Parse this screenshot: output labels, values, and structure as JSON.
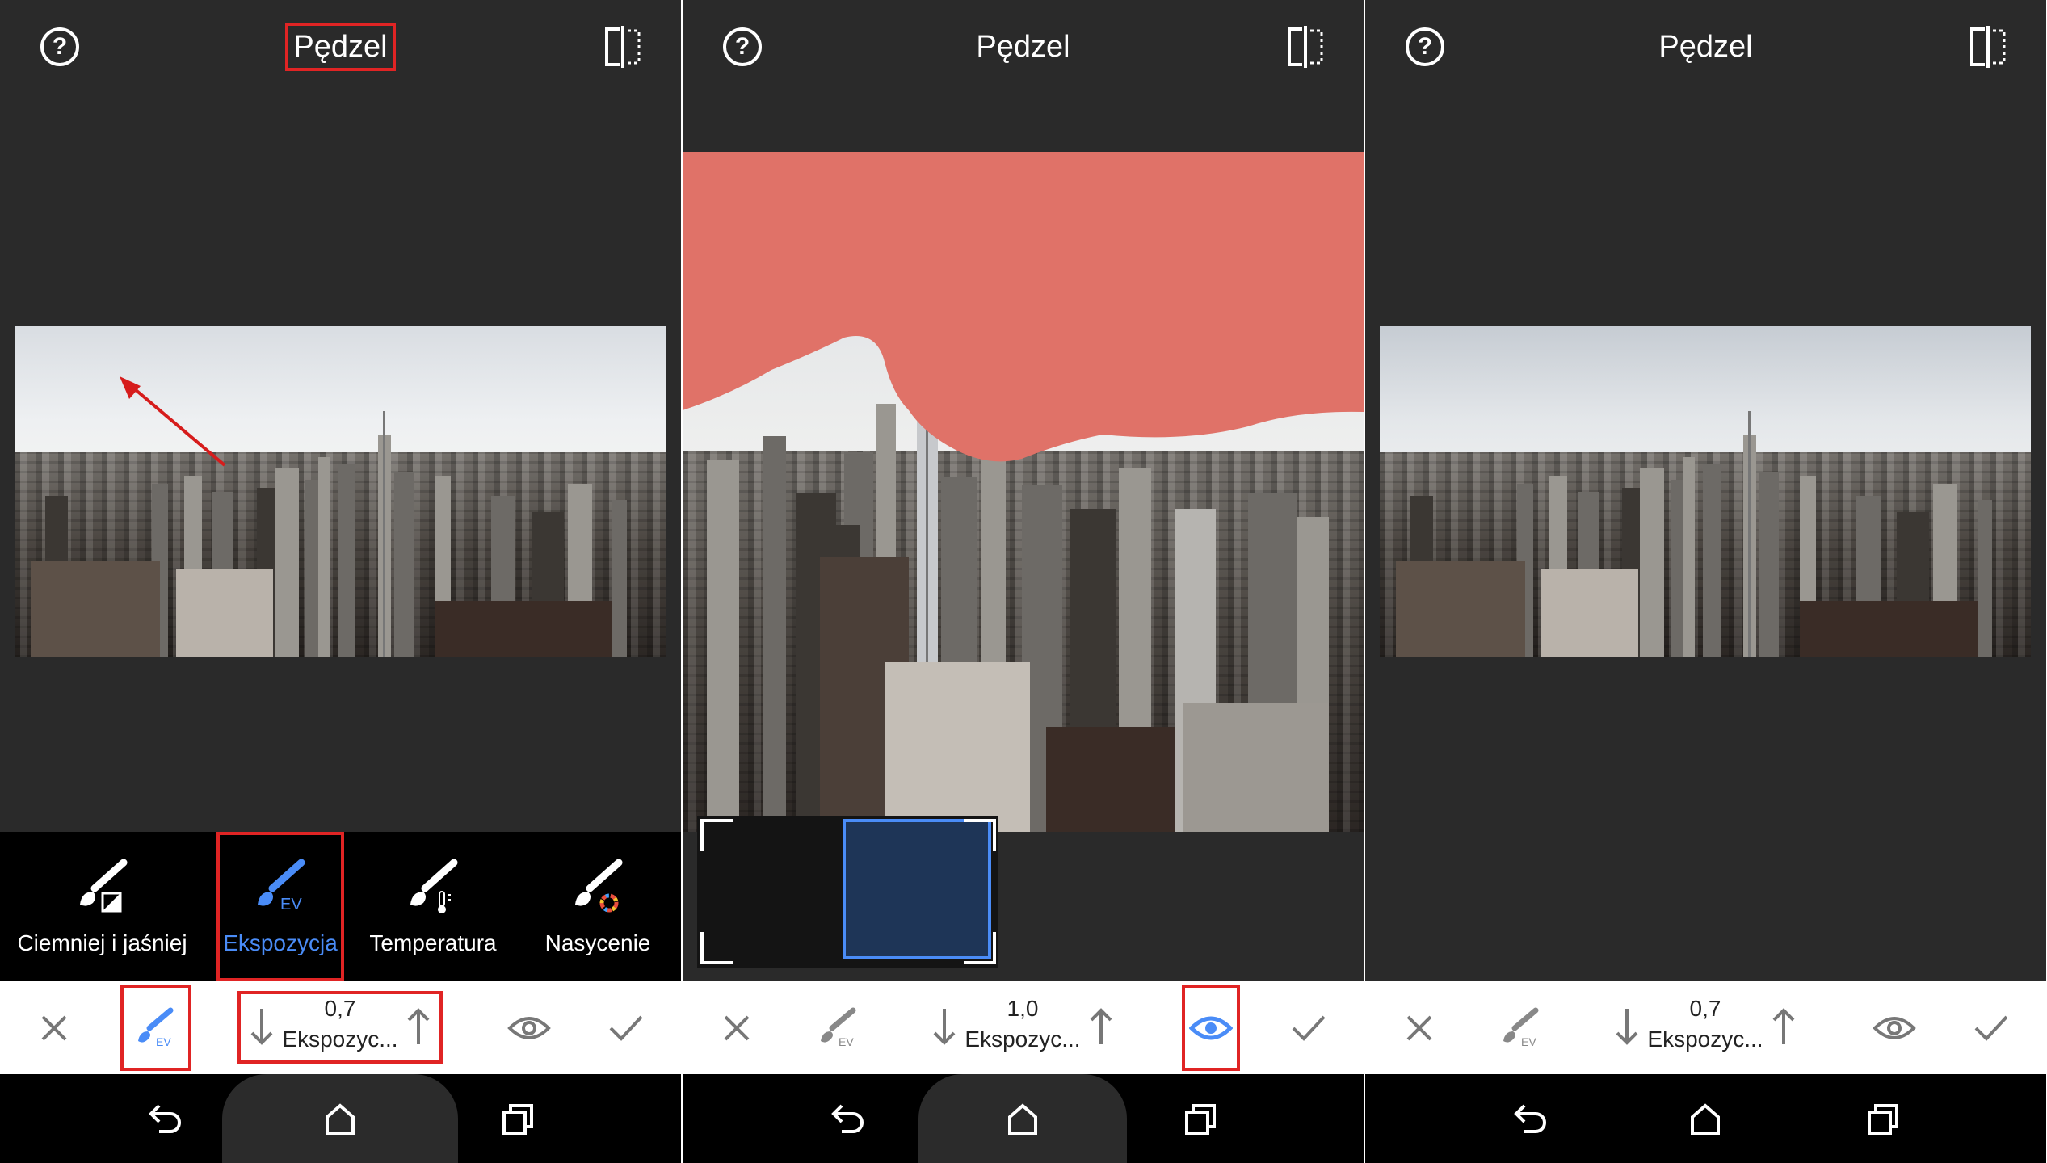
{
  "panels": [
    {
      "title": "Pędzel",
      "help_glyph": "?",
      "tools": [
        {
          "label": "Ciemniej i jaśniej",
          "icon": "brush-dodge-burn-icon"
        },
        {
          "label": "Ekspozycja",
          "icon": "brush-exposure-icon",
          "badge": "EV",
          "active": true
        },
        {
          "label": "Temperatura",
          "icon": "brush-temperature-icon"
        },
        {
          "label": "Nasycenie",
          "icon": "brush-saturation-icon"
        }
      ],
      "value": "0,7",
      "value_label": "Ekspozyc...",
      "brush_badge": "EV"
    },
    {
      "title": "Pędzel",
      "help_glyph": "?",
      "value": "1,0",
      "value_label": "Ekspozyc...",
      "brush_badge": "EV"
    },
    {
      "title": "Pędzel",
      "help_glyph": "?",
      "value": "0,7",
      "value_label": "Ekspozyc...",
      "brush_badge": "EV"
    }
  ],
  "colors": {
    "highlight_red": "#e02424",
    "accent_blue": "#4a8cf7",
    "mask_red": "#e07268",
    "background": "#2a2a2a"
  },
  "icons": {
    "help": "help-circle-icon",
    "compare": "compare-split-icon",
    "cancel": "close-icon",
    "brush": "brush-icon",
    "decrease": "arrow-down-icon",
    "increase": "arrow-up-icon",
    "visibility": "eye-icon",
    "apply": "checkmark-icon",
    "back": "back-icon",
    "home": "home-icon",
    "recents": "recents-icon"
  }
}
